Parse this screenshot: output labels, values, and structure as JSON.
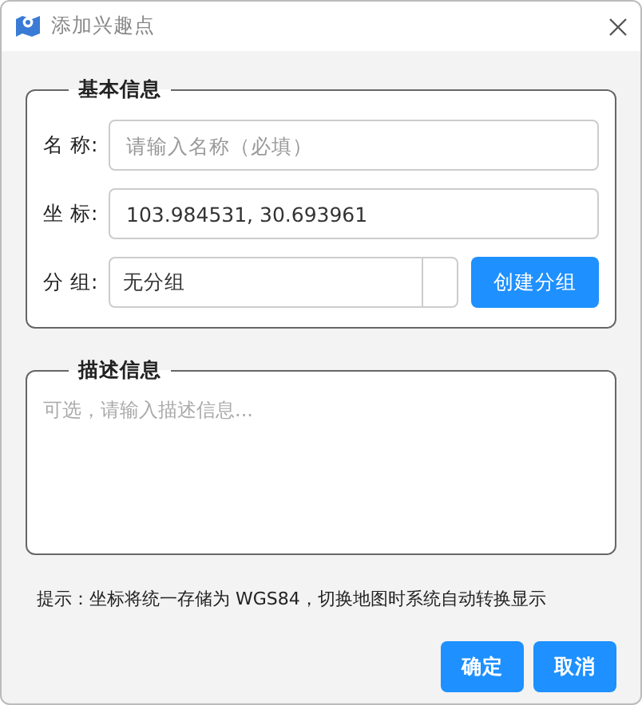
{
  "window": {
    "title": "添加兴趣点"
  },
  "basic_info": {
    "legend": "基本信息",
    "name": {
      "label": "名 称:",
      "placeholder": "请输入名称（必填）"
    },
    "coordinates": {
      "label": "坐 标:",
      "value": "103.984531, 30.693961"
    },
    "group": {
      "label": "分 组:",
      "value": "无分组",
      "button": "创建分组"
    }
  },
  "description": {
    "legend": "描述信息",
    "placeholder": "可选，请输入描述信息..."
  },
  "hint": "提示：坐标将统一存储为 WGS84，切换地图时系统自动转换显示",
  "buttons": [
    "确定",
    "取消"
  ]
}
